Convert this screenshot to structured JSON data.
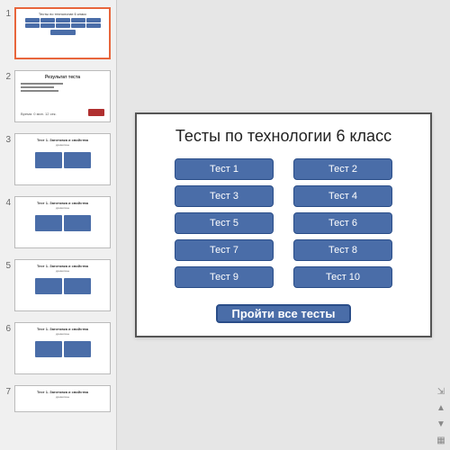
{
  "thumbs": {
    "numbers": [
      "1",
      "2",
      "3",
      "4",
      "5",
      "6",
      "7"
    ]
  },
  "slide": {
    "title": "Тесты по технологии 6 класс",
    "tests": [
      "Тест 1",
      "Тест 2",
      "Тест 3",
      "Тест 4",
      "Тест 5",
      "Тест 6",
      "Тест 7",
      "Тест 8",
      "Тест 9",
      "Тест 10"
    ],
    "all_label": "Пройти все тесты"
  },
  "colors": {
    "button_bg": "#4a6da8",
    "button_border": "#2a4d88",
    "active_thumb": "#e8663c"
  }
}
